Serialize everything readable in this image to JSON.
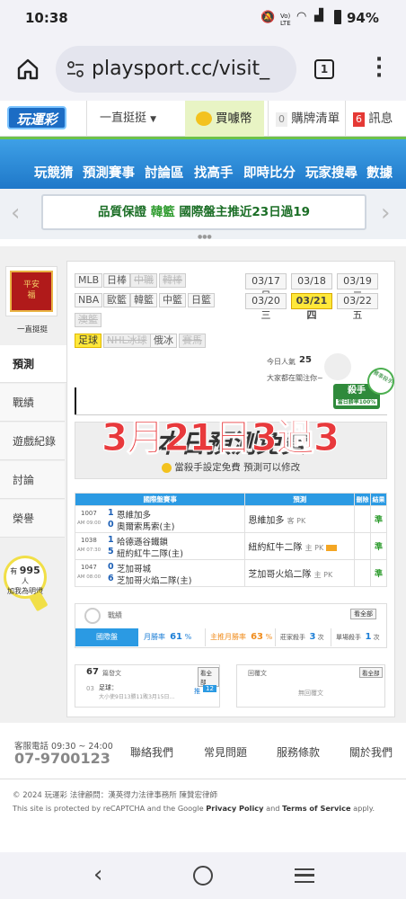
{
  "status": {
    "time": "10:38",
    "battery": "94%",
    "net": "Vo) LTE"
  },
  "browser": {
    "url": "playsport.cc/visit_",
    "tabs": "1"
  },
  "topnav": {
    "logo": "玩運彩",
    "dropdown": "一直挺挺",
    "coin": "買噱幣",
    "cart_count": "0",
    "cart": "購牌清單",
    "msg_count": "6",
    "msg": "訊息"
  },
  "mainnav": [
    "玩競猜",
    "預測賽事",
    "討論區",
    "找高手",
    "即時比分",
    "玩家搜尋",
    "數據"
  ],
  "banner": {
    "a": "品質保證",
    "b": "韓籃",
    "c": "國際盤主推近23日過19"
  },
  "profile": {
    "name": "一直挺挺",
    "avatar_text": "平安"
  },
  "sidemenu": [
    "預測",
    "戰績",
    "遊戲紀錄",
    "討論",
    "榮譽"
  ],
  "bulb": {
    "pre": "有",
    "count": "995",
    "post": "人",
    "line2": "加我為明燈"
  },
  "leagues": {
    "row1": [
      "MLB",
      "日棒",
      "中職",
      "韓棒"
    ],
    "row2": [
      "NBA",
      "歐籃",
      "韓籃",
      "中籃",
      "日籃"
    ],
    "row3": [
      "澳籃"
    ],
    "row4": [
      "足球",
      "NHL冰球",
      "俄冰",
      "賽馬"
    ]
  },
  "dates": [
    "03/17 日",
    "03/18 一",
    "03/19 二",
    "03/20 三",
    "03/21 四",
    "03/22 五"
  ],
  "popularity": {
    "label": "今日人氣",
    "value": "25",
    "sub": "大家都在關注你~"
  },
  "badge": {
    "main": "殺手",
    "sub": "當日勝率100%",
    "tag": "賽事殺手"
  },
  "overlay": "3月21日3過3",
  "freebanner": {
    "title": "本日預測免費",
    "sub": "當殺手設定免費  預測可以修改"
  },
  "table": {
    "h1": "國際盤賽事",
    "h2": "預測",
    "h3": "刪除",
    "h4": "結果",
    "rows": [
      {
        "no": "1007",
        "time": "AM 09:00",
        "s1": "1",
        "t1": "恩維加多",
        "s2": "0",
        "t2": "奧爾索馬索(主)",
        "pick": "恩維加多",
        "ptype": "客 PK",
        "res": "準"
      },
      {
        "no": "1038",
        "time": "AM 07:30",
        "s1": "1",
        "t1": "哈德遜谷鐵鎖",
        "s2": "5",
        "t2": "紐約紅牛二隊(主)",
        "pick": "紐約紅牛二隊",
        "ptype": "主 PK",
        "res": "準"
      },
      {
        "no": "1047",
        "time": "AM 08:00",
        "s1": "0",
        "t1": "芝加哥城",
        "s2": "6",
        "t2": "芝加哥火焰二隊(主)",
        "pick": "芝加哥火焰二隊",
        "ptype": "主 PK",
        "res": "準"
      }
    ]
  },
  "record": {
    "title": "戰績",
    "btn": "看全部",
    "tab": "國際盤",
    "win_label": "月勝率",
    "win": "61",
    "host_label": "主推月勝率",
    "host": "63",
    "pct": "%",
    "kill_label": "莊家殺手",
    "kill": "3",
    "kill_unit": "次",
    "single_label": "單場殺手",
    "single": "1",
    "single_unit": "次"
  },
  "posts": {
    "count": "67",
    "label": "篇發文",
    "btn": "看全部",
    "no": "03",
    "cat": "足球：",
    "text": "大小使9日13勝11敗3月15日...",
    "tag": "推",
    "num": "12",
    "right_label": "回覆文",
    "right_btn": "看全部",
    "empty": "無回覆文"
  },
  "footer": {
    "phone_label": "客服電話 09:30 ~ 24:00",
    "phone": "07-9700123",
    "links": [
      "聯絡我們",
      "常見問題",
      "服務條款",
      "關於我們"
    ],
    "copyright": "© 2024 玩運彩  法律顧問：漢英得力法律事務所 陳贊宏律師",
    "recaptcha1": "This site is protected by reCAPTCHA and the Google ",
    "pp": "Privacy Policy",
    "and": " and ",
    "tos": "Terms of Service",
    "apply": " apply."
  }
}
